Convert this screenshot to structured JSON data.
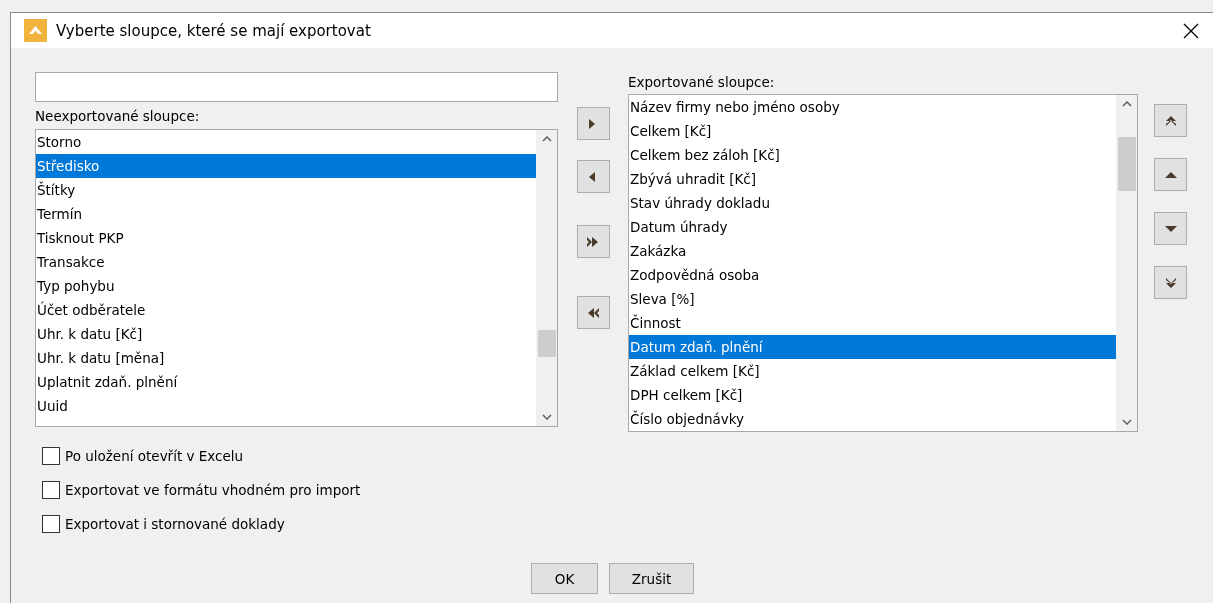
{
  "window": {
    "title": "Vyberte sloupce, které se mají exportovat"
  },
  "available": {
    "label": "Neexportované sloupce:",
    "items": [
      {
        "text": "Storno",
        "selected": false
      },
      {
        "text": "Středisko",
        "selected": true
      },
      {
        "text": "Štítky",
        "selected": false
      },
      {
        "text": "Termín",
        "selected": false
      },
      {
        "text": "Tisknout PKP",
        "selected": false
      },
      {
        "text": "Transakce",
        "selected": false
      },
      {
        "text": "Typ pohybu",
        "selected": false
      },
      {
        "text": "Účet odběratele",
        "selected": false
      },
      {
        "text": "Uhr. k datu [Kč]",
        "selected": false
      },
      {
        "text": "Uhr. k datu [měna]",
        "selected": false
      },
      {
        "text": "Uplatnit zdaň. plnění",
        "selected": false
      },
      {
        "text": "Uuid",
        "selected": false
      }
    ]
  },
  "move_buttons": [
    {
      "kind": "right"
    },
    {
      "kind": "left"
    },
    {
      "kind": "all-right"
    },
    {
      "kind": "all-left"
    }
  ],
  "exported": {
    "label": "Exportované sloupce:",
    "items": [
      {
        "text": "Název firmy nebo jméno osoby",
        "selected": false
      },
      {
        "text": "Celkem [Kč]",
        "selected": false
      },
      {
        "text": "Celkem bez záloh [Kč]",
        "selected": false
      },
      {
        "text": "Zbývá uhradit [Kč]",
        "selected": false
      },
      {
        "text": "Stav úhrady dokladu",
        "selected": false
      },
      {
        "text": "Datum úhrady",
        "selected": false
      },
      {
        "text": "Zakázka",
        "selected": false
      },
      {
        "text": "Zodpovědná osoba",
        "selected": false
      },
      {
        "text": "Sleva [%]",
        "selected": false
      },
      {
        "text": "Činnost",
        "selected": false
      },
      {
        "text": "Datum zdaň. plnění",
        "selected": true
      },
      {
        "text": "Základ celkem [Kč]",
        "selected": false
      },
      {
        "text": "DPH celkem [Kč]",
        "selected": false
      },
      {
        "text": "Číslo objednávky",
        "selected": false
      }
    ]
  },
  "order_buttons": [
    {
      "kind": "top"
    },
    {
      "kind": "up"
    },
    {
      "kind": "down"
    },
    {
      "kind": "bottom"
    }
  ],
  "options": [
    {
      "label": "Po uložení otevřít v Excelu",
      "checked": false
    },
    {
      "label": "Exportovat ve formátu vhodném pro import",
      "checked": false
    },
    {
      "label": "Exportovat i stornované doklady",
      "checked": false
    }
  ],
  "buttons": [
    {
      "label": "OK"
    },
    {
      "label": "Zrušit"
    }
  ]
}
